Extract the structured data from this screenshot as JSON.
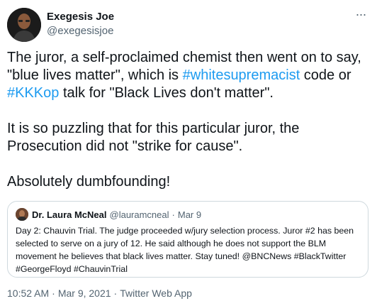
{
  "author": {
    "display_name": "Exegesis Joe",
    "handle": "@exegesisjoe"
  },
  "more_icon": "three-dots-icon",
  "tweet": {
    "p1_a": "The juror, a self-proclaimed chemist then went on to say, \"blue lives matter\", which is ",
    "p1_tag1": "#whitesupremacist",
    "p1_b": " code or ",
    "p1_tag2": "#KKKop",
    "p1_c": " talk for \"Black Lives don't matter\".",
    "p2": "It is so puzzling that for this particular juror, the Prosecution did not \"strike for cause\".",
    "p3": "Absolutely dumbfounding!"
  },
  "quote": {
    "display_name": "Dr. Laura McNeal",
    "handle": "@lauramcneal",
    "separator": "·",
    "date": "Mar 9",
    "text": "Day 2: Chauvin Trial. The judge proceeded w/jury selection process. Juror #2 has been selected to serve on a jury of 12. He said although he does not support the BLM movement he believes that black lives matter. Stay tuned! @BNCNews #BlackTwitter #GeorgeFloyd #ChauvinTrial"
  },
  "meta": {
    "time": "10:52 AM",
    "date": "Mar 9, 2021",
    "source": "Twitter Web App",
    "separator": "·"
  },
  "colors": {
    "accent": "#1d9bf0",
    "secondary_text": "#536471",
    "border": "#cfd9de"
  }
}
